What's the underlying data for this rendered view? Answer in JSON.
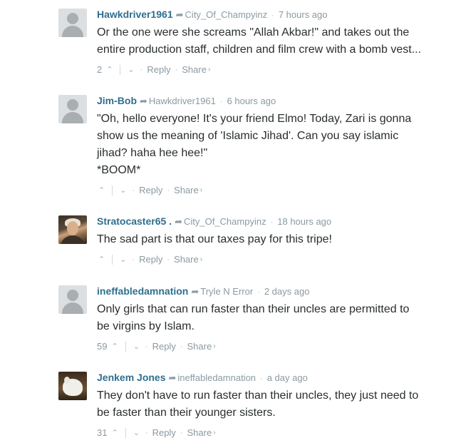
{
  "comments": [
    {
      "author": "Hawkdriver1961",
      "parent": "City_Of_Champyinz",
      "time": "7 hours ago",
      "lines": [
        "Or the one were she screams \"Allah Akbar!\" and takes out the",
        "entire production staff, children and film crew with a bomb vest..."
      ],
      "votes": "2",
      "avatar": "default-avatar"
    },
    {
      "author": "Jim-Bob",
      "parent": "Hawkdriver1961",
      "time": "6 hours ago",
      "lines": [
        "\"Oh, hello everyone! It's your friend Elmo! Today, Zari is gonna",
        "show us the meaning of 'Islamic Jihad'. Can you say islamic",
        "jihad? haha hee hee!\"",
        "*BOOM*"
      ],
      "votes": "",
      "avatar": "default-avatar"
    },
    {
      "author": "Stratocaster65 .",
      "parent": "City_Of_Champyinz",
      "time": "18 hours ago",
      "lines": [
        "The sad part is that our taxes pay for this tripe!"
      ],
      "votes": "",
      "avatar": "portrait-avatar"
    },
    {
      "author": "ineffabledamnation",
      "parent": "Tryle N Error",
      "time": "2 days ago",
      "lines": [
        "Only girls that can run faster than their uncles are permitted to",
        "be virgins by Islam."
      ],
      "votes": "59",
      "avatar": "default-avatar"
    },
    {
      "author": "Jenkem Jones",
      "parent": "ineffabledamnation",
      "time": "a day ago",
      "lines": [
        "They don't have to run faster than their uncles, they just need to",
        "be faster than their younger sisters."
      ],
      "votes": "31",
      "avatar": "dog-avatar"
    }
  ],
  "labels": {
    "reply": "Reply",
    "share": "Share",
    "upvote_glyph": "⌃",
    "downvote_glyph": "⌄",
    "separator": "·",
    "reply_arrow_glyph": "➦",
    "chevron_glyph": "›"
  },
  "colors": {
    "author": "#2e6f8e",
    "muted": "#8a9aa3",
    "text": "#2a2e2e"
  }
}
